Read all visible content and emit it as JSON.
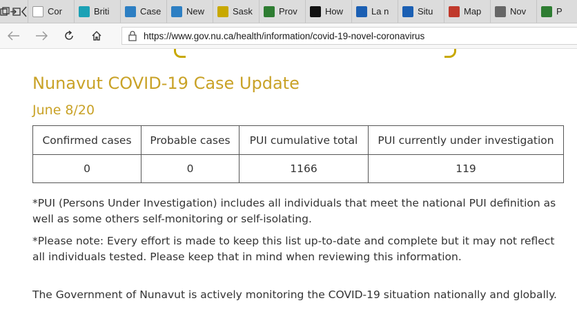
{
  "tabs": [
    {
      "label": "Cor",
      "icon": "timeline-icon",
      "color": "#ffffff"
    },
    {
      "label": "Briti",
      "icon": "bc-shield-icon",
      "color": "#1ba1b5"
    },
    {
      "label": "Case",
      "icon": "alberta-icon",
      "color": "#2d7fc3"
    },
    {
      "label": "New",
      "icon": "alberta-icon",
      "color": "#2d7fc3"
    },
    {
      "label": "Sask",
      "icon": "sask-icon",
      "color": "#c8a800"
    },
    {
      "label": "Prov",
      "icon": "manitoba-icon",
      "color": "#2e7d32"
    },
    {
      "label": "How",
      "icon": "ontario-icon",
      "color": "#111111"
    },
    {
      "label": "La n",
      "icon": "quebec-icon",
      "color": "#1b5fb3"
    },
    {
      "label": "Situ",
      "icon": "quebec-icon",
      "color": "#1b5fb3"
    },
    {
      "label": "Map",
      "icon": "map-icon",
      "color": "#c0392b"
    },
    {
      "label": "Nov",
      "icon": "email-icon",
      "color": "#666666"
    },
    {
      "label": "P",
      "icon": "gov-icon",
      "color": "#2e7d32"
    }
  ],
  "address_bar": {
    "url": "https://www.gov.nu.ca/health/information/covid-19-novel-coronavirus"
  },
  "page": {
    "title": "Nunavut COVID-19 Case Update",
    "date": "June 8/20",
    "table": {
      "headers": [
        "Confirmed cases",
        "Probable cases",
        "PUI cumulative total",
        "PUI currently under investigation"
      ],
      "row": [
        "0",
        "0",
        "1166",
        "119"
      ]
    },
    "note1": "*PUI (Persons Under Investigation) includes all individuals that meet the national PUI definition as well as some others self-monitoring or self-isolating.",
    "note2": "*Please note: Every effort is made to keep this list up-to-date and complete but it may not reflect all individuals tested. Please keep that in mind when reviewing this information.",
    "intro": "The Government of Nunavut is actively monitoring the COVID-19 situation nationally and globally."
  },
  "colors": {
    "accent": "#c9a227",
    "text": "#333333"
  }
}
